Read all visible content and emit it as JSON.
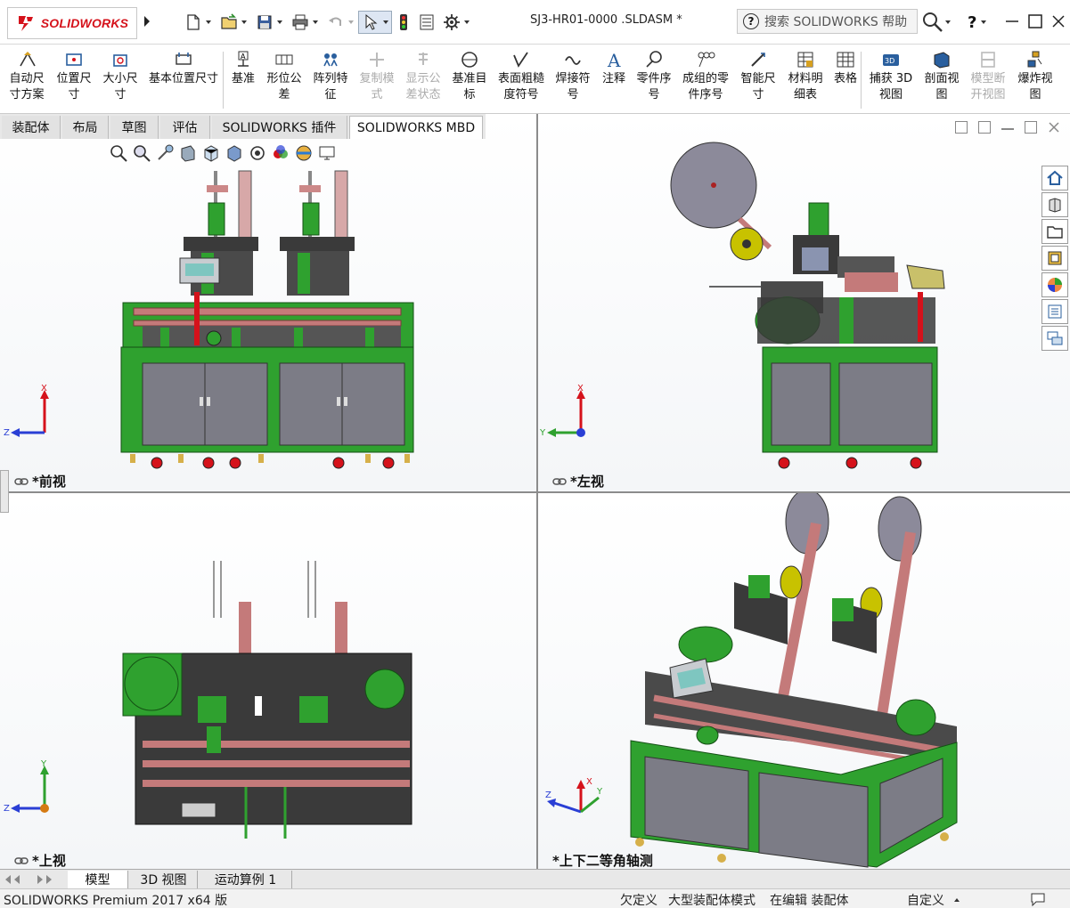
{
  "app": {
    "brand": "SOLIDWORKS",
    "doc_title": "SJ3-HR01-0000 .SLDASM *"
  },
  "search": {
    "placeholder": "搜索 SOLIDWORKS 帮助"
  },
  "help": {
    "label": "?"
  },
  "ribbon": [
    {
      "line1": "自动尺",
      "line2": "寸方案",
      "icon": "auto-dimension-icon",
      "enabled": true
    },
    {
      "line1": "位置尺",
      "line2": "寸",
      "icon": "location-dimension-icon",
      "enabled": true
    },
    {
      "line1": "大小尺",
      "line2": "寸",
      "icon": "size-dimension-icon",
      "enabled": true
    },
    {
      "line1": "基本位置尺寸",
      "line2": "",
      "icon": "basic-location-dimension-icon",
      "enabled": true
    },
    {
      "line1": "基准",
      "line2": "",
      "icon": "datum-icon",
      "enabled": true
    },
    {
      "line1": "形位公",
      "line2": "差",
      "icon": "geometric-tolerance-icon",
      "enabled": true
    },
    {
      "line1": "阵列特",
      "line2": "征",
      "icon": "pattern-feature-icon",
      "enabled": true
    },
    {
      "line1": "复制模",
      "line2": "式",
      "icon": "copy-scheme-icon",
      "enabled": false
    },
    {
      "line1": "显示公",
      "line2": "差状态",
      "icon": "show-tolerance-status-icon",
      "enabled": false
    },
    {
      "line1": "基准目",
      "line2": "标",
      "icon": "datum-target-icon",
      "enabled": true
    },
    {
      "line1": "表面粗糙",
      "line2": "度符号",
      "icon": "surface-finish-icon",
      "enabled": true
    },
    {
      "line1": "焊接符",
      "line2": "号",
      "icon": "weld-symbol-icon",
      "enabled": true
    },
    {
      "line1": "注释",
      "line2": "",
      "icon": "note-icon",
      "enabled": true
    },
    {
      "line1": "零件序",
      "line2": "号",
      "icon": "balloon-icon",
      "enabled": true
    },
    {
      "line1": "成组的零",
      "line2": "件序号",
      "icon": "stacked-balloon-icon",
      "enabled": true
    },
    {
      "line1": "智能尺",
      "line2": "寸",
      "icon": "smart-dimension-icon",
      "enabled": true
    },
    {
      "line1": "材料明",
      "line2": "细表",
      "icon": "bom-icon",
      "enabled": true
    },
    {
      "line1": "表格",
      "line2": "",
      "icon": "table-icon",
      "enabled": true
    },
    {
      "line1": "捕获 3D",
      "line2": "视图",
      "icon": "capture-3d-view-icon",
      "enabled": true
    },
    {
      "line1": "剖面视",
      "line2": "图",
      "icon": "section-view-icon",
      "enabled": true
    },
    {
      "line1": "模型断",
      "line2": "开视图",
      "icon": "model-break-view-icon",
      "enabled": false
    },
    {
      "line1": "爆炸视",
      "line2": "图",
      "icon": "exploded-view-icon",
      "enabled": true
    }
  ],
  "tabs": [
    "装配体",
    "布局",
    "草图",
    "评估",
    "SOLIDWORKS 插件",
    "SOLIDWORKS MBD"
  ],
  "viewports": {
    "front": "*前视",
    "left": "*左视",
    "top": "*上视",
    "iso": "*上下二等角轴测"
  },
  "axes": {
    "x": "X",
    "y": "Y",
    "z": "Z"
  },
  "bottom_tabs": [
    "模型",
    "3D 视图",
    "运动算例 1"
  ],
  "status": {
    "product": "SOLIDWORKS Premium 2017 x64 版",
    "underdefined": "欠定义",
    "large_assembly": "大型装配体模式",
    "editing": "在编辑 装配体",
    "custom": "自定义"
  },
  "colors": {
    "green": "#2fa12f",
    "gray": "#7c7c86",
    "pink": "#c47a7a",
    "red": "#d5121b",
    "dark": "#3a3a3a",
    "brand": "#d5121b"
  }
}
